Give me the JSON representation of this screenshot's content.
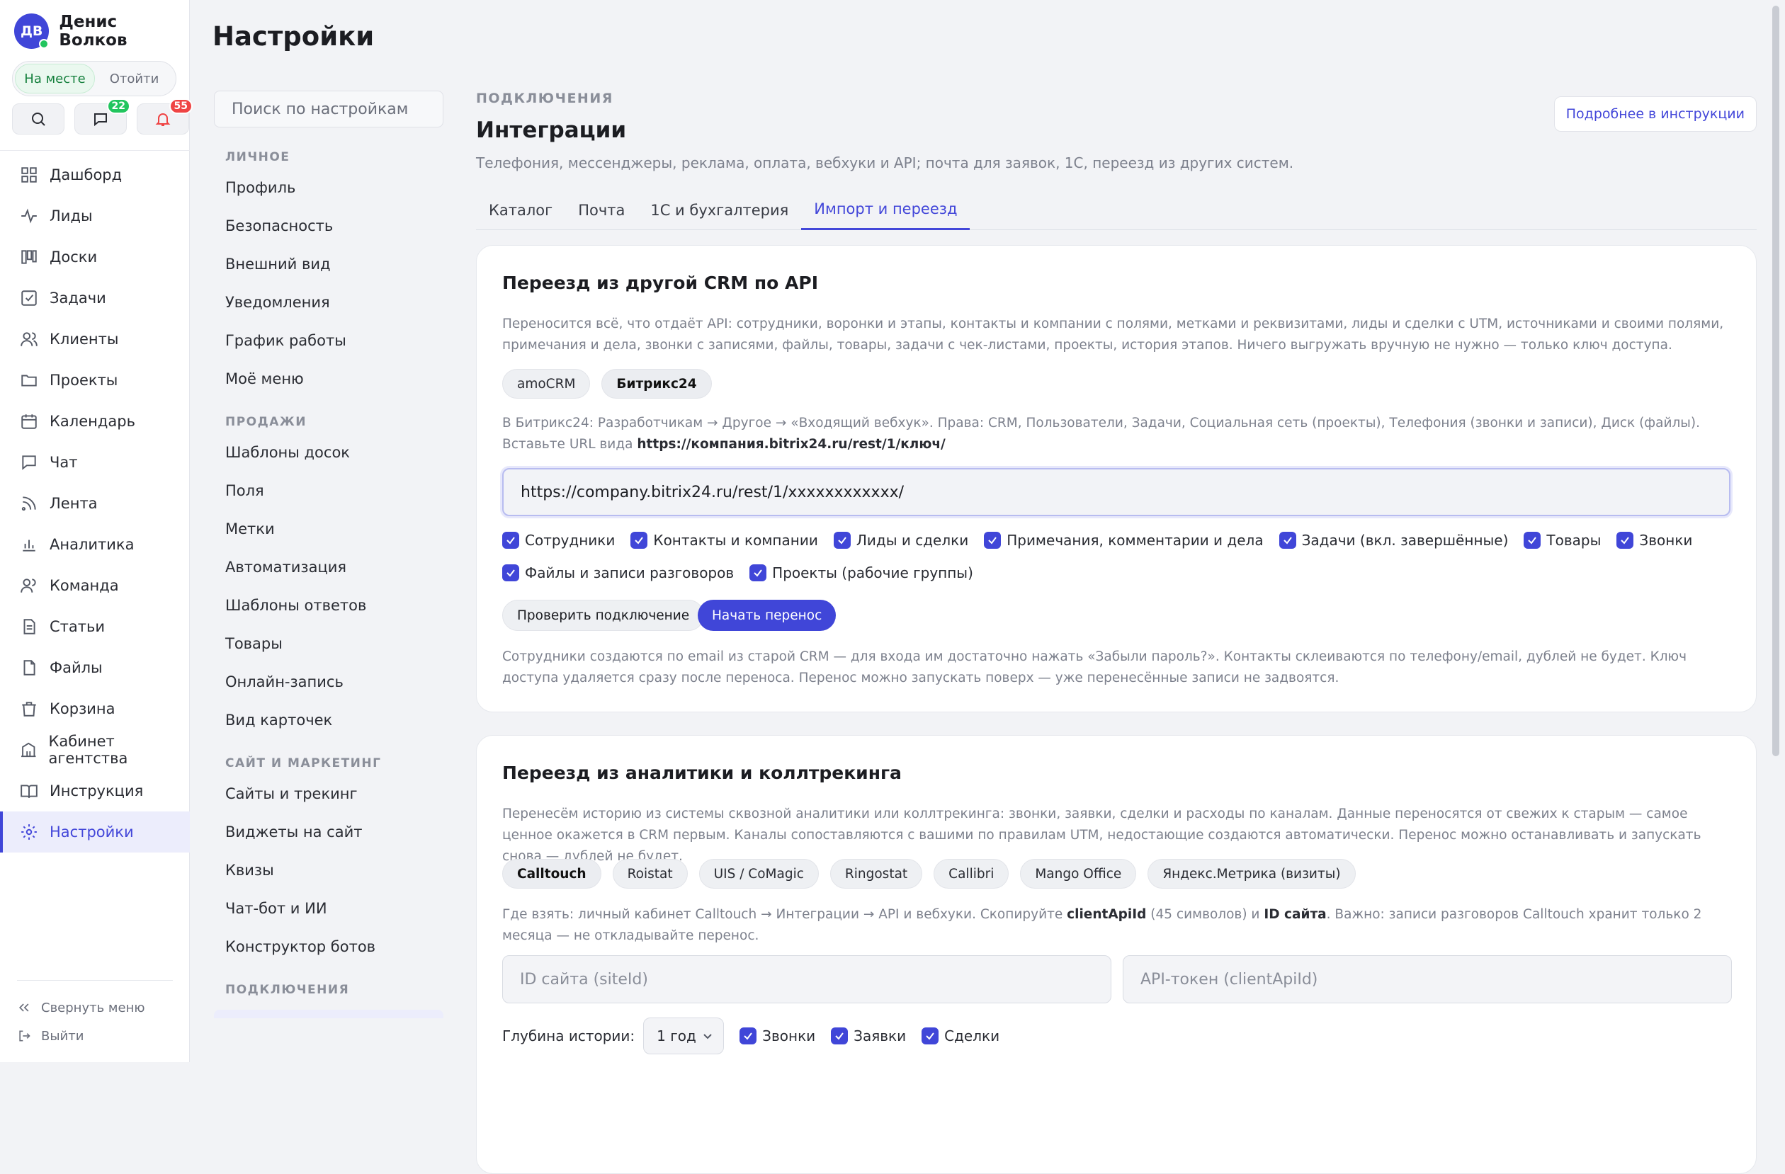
{
  "user": {
    "initials": "ДВ",
    "name": "Денис Волков"
  },
  "status": {
    "present": "На месте",
    "away": "Отойти"
  },
  "toolbar": {
    "messages_count": "22",
    "notifications_count": "55"
  },
  "nav": [
    {
      "label": "Дашборд",
      "icon": "dashboard-icon"
    },
    {
      "label": "Лиды",
      "icon": "activity-icon"
    },
    {
      "label": "Доски",
      "icon": "kanban-icon"
    },
    {
      "label": "Задачи",
      "icon": "task-icon"
    },
    {
      "label": "Клиенты",
      "icon": "users-icon"
    },
    {
      "label": "Проекты",
      "icon": "folder-icon"
    },
    {
      "label": "Календарь",
      "icon": "calendar-icon"
    },
    {
      "label": "Чат",
      "icon": "chat-icon"
    },
    {
      "label": "Лента",
      "icon": "feed-icon"
    },
    {
      "label": "Аналитика",
      "icon": "chart-icon"
    },
    {
      "label": "Команда",
      "icon": "team-icon"
    },
    {
      "label": "Статьи",
      "icon": "article-icon"
    },
    {
      "label": "Файлы",
      "icon": "file-icon"
    },
    {
      "label": "Корзина",
      "icon": "trash-icon"
    },
    {
      "label": "Кабинет агентства",
      "icon": "building-icon"
    },
    {
      "label": "Инструкция",
      "icon": "book-icon"
    },
    {
      "label": "Настройки",
      "icon": "gear-icon"
    }
  ],
  "sidebar_footer": {
    "collapse": "Свернуть меню",
    "logout": "Выйти"
  },
  "page": {
    "title": "Настройки"
  },
  "subnav": {
    "search_placeholder": "Поиск по настройкам",
    "groups": [
      {
        "title": "ЛИЧНОЕ",
        "items": [
          "Профиль",
          "Безопасность",
          "Внешний вид",
          "Уведомления",
          "График работы",
          "Моё меню"
        ]
      },
      {
        "title": "ПРОДАЖИ",
        "items": [
          "Шаблоны досок",
          "Поля",
          "Метки",
          "Автоматизация",
          "Шаблоны ответов",
          "Товары",
          "Онлайн-запись",
          "Вид карточек"
        ]
      },
      {
        "title": "САЙТ И МАРКЕТИНГ",
        "items": [
          "Сайты и трекинг",
          "Виджеты на сайт",
          "Квизы",
          "Чат-бот и ИИ",
          "Конструктор ботов"
        ]
      },
      {
        "title": "ПОДКЛЮЧЕНИЯ",
        "items": []
      }
    ]
  },
  "main": {
    "kicker": "ПОДКЛЮЧЕНИЯ",
    "title": "Интеграции",
    "subtitle": "Телефония, мессенджеры, реклама, оплата, вебхуки и API; почта для заявок, 1С, переезд из других систем.",
    "help_link": "Подробнее в инструкции",
    "tabs": [
      "Каталог",
      "Почта",
      "1С и бухгалтерия",
      "Импорт и переезд"
    ]
  },
  "crm_card": {
    "title": "Переезд из другой CRM по API",
    "description": "Переносится всё, что отдаёт API: сотрудники, воронки и этапы, контакты и компании с полями, метками и реквизитами, лиды и сделки с UTM, источниками и своими полями, примечания и дела, звонки с записями, файлы, товары, задачи с чек-листами, проекты, история этапов. Ничего выгружать вручную не нужно — только ключ доступа.",
    "sources": [
      "amoCRM",
      "Битрикс24"
    ],
    "hint_text": "В Битрикс24: Разработчикам → Другое → «Входящий вебхук». Права: CRM, Пользователи, Задачи, Социальная сеть (проекты), Телефония (звонки и записи), Диск (файлы). Вставьте URL вида",
    "hint_url": "https://компания.bitrix24.ru/rest/1/ключ/",
    "url_value": "https://company.bitrix24.ru/rest/1/xxxxxxxxxxxx/",
    "checks": [
      "Сотрудники",
      "Контакты и компании",
      "Лиды и сделки",
      "Примечания, комментарии и дела",
      "Задачи (вкл. завершённые)",
      "Товары",
      "Звонки",
      "Файлы и записи разговоров",
      "Проекты (рабочие группы)"
    ],
    "check_button": "Проверить подключение",
    "start_button": "Начать перенос",
    "footnote": "Сотрудники создаются по email из старой CRM — для входа им достаточно нажать «Забыли пароль?». Контакты склеиваются по телефону/email, дублей не будет. Ключ доступа удаляется сразу после переноса. Перенос можно запускать поверх — уже перенесённые записи не задвоятся."
  },
  "analytics_card": {
    "title": "Переезд из аналитики и коллтрекинга",
    "description": "Перенесём историю из системы сквозной аналитики или коллтрекинга: звонки, заявки, сделки и расходы по каналам. Данные переносятся от свежих к старым — самое ценное окажется в CRM первым. Каналы сопоставляются с вашими по правилам UTM, недостающие создаются автоматически. Перенос можно останавливать и запускать снова — дублей не будет.",
    "sources": [
      "Calltouch",
      "Roistat",
      "UIS / CoMagic",
      "Ringostat",
      "Callibri",
      "Mango Office",
      "Яндекс.Метрика (визиты)"
    ],
    "hint_1": "Где взять: личный кабинет Calltouch → Интеграции → API и вебхуки. Скопируйте",
    "hint_key1": "clientApiId",
    "hint_2": "(45 символов) и",
    "hint_key2": "ID сайта",
    "hint_3": ". Важно: записи разговоров Calltouch хранит только 2 месяца — не откладывайте перенос.",
    "site_id_placeholder": "ID сайта (siteId)",
    "token_placeholder": "API-токен (clientApiId)",
    "depth_label": "Глубина истории:",
    "depth_value": "1 год",
    "checks": [
      "Звонки",
      "Заявки",
      "Сделки"
    ]
  }
}
